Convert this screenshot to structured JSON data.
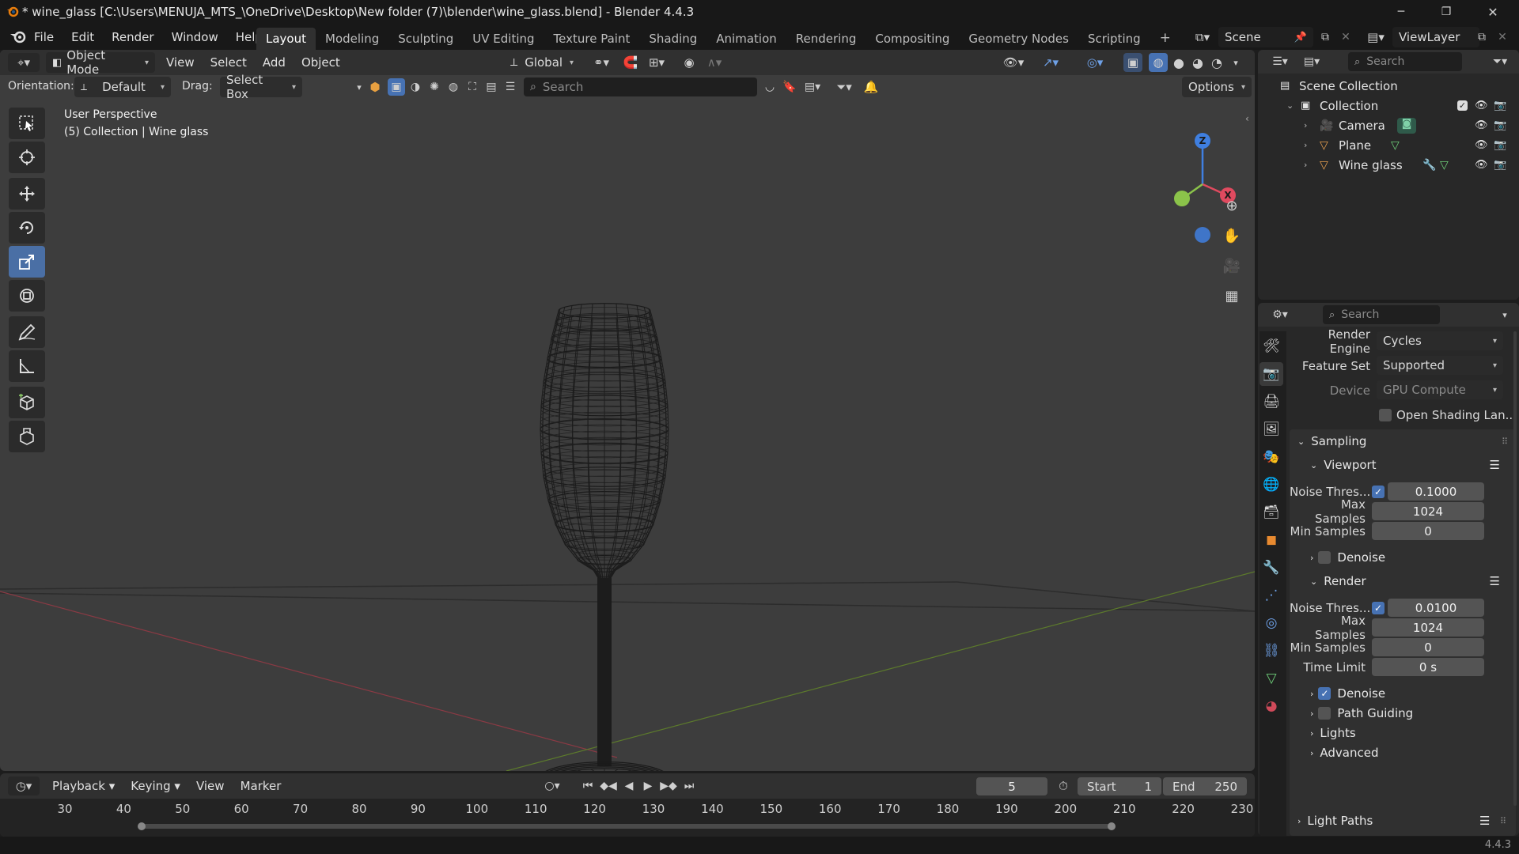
{
  "titlebar": {
    "title": "* wine_glass [C:\\Users\\MENUJA_MTS_\\OneDrive\\Desktop\\New folder (7)\\blender\\wine_glass.blend] - Blender 4.4.3",
    "minimize": "─",
    "maximize": "❐",
    "close": "✕"
  },
  "menubar": {
    "menus": [
      "File",
      "Edit",
      "Render",
      "Window",
      "Help"
    ],
    "workspaces": [
      "Layout",
      "Modeling",
      "Sculpting",
      "UV Editing",
      "Texture Paint",
      "Shading",
      "Animation",
      "Rendering",
      "Compositing",
      "Geometry Nodes",
      "Scripting"
    ],
    "active_workspace": "Layout",
    "add_workspace": "+",
    "scene": "Scene",
    "view_layer": "ViewLayer"
  },
  "viewport_header": {
    "mode": "Object Mode",
    "menus": [
      "View",
      "Select",
      "Add",
      "Object"
    ],
    "orientation_transform": "Global"
  },
  "tool_settings": {
    "orientation_label": "Orientation:",
    "orientation_value": "Default",
    "drag_label": "Drag:",
    "drag_value": "Select Box",
    "search_placeholder": "Search",
    "options": "Options"
  },
  "viewport": {
    "perspective": "User Perspective",
    "collection_info": "(5) Collection | Wine glass",
    "gizmo": {
      "z": "Z",
      "x": "X"
    }
  },
  "outliner": {
    "search_placeholder": "Search",
    "scene_collection": "Scene Collection",
    "collection": "Collection",
    "objects": [
      {
        "name": "Camera",
        "icon": "camera-icon"
      },
      {
        "name": "Plane",
        "icon": "mesh-icon"
      },
      {
        "name": "Wine glass",
        "icon": "mesh-icon"
      }
    ]
  },
  "properties": {
    "search_placeholder": "Search",
    "render_engine_label": "Render Engine",
    "render_engine": "Cycles",
    "feature_set_label": "Feature Set",
    "feature_set": "Supported",
    "device_label": "Device",
    "device": "GPU Compute",
    "osl_label": "Open Shading Lan...",
    "sampling": {
      "title": "Sampling",
      "viewport": {
        "title": "Viewport",
        "noise_label": "Noise Thres...",
        "noise_value": "0.1000",
        "noise_enabled": true,
        "max_samples_label": "Max Samples",
        "max_samples": "1024",
        "min_samples_label": "Min Samples",
        "min_samples": "0",
        "denoise_label": "Denoise",
        "denoise_enabled": false
      },
      "render": {
        "title": "Render",
        "noise_label": "Noise Thres...",
        "noise_value": "0.0100",
        "noise_enabled": true,
        "max_samples_label": "Max Samples",
        "max_samples": "1024",
        "min_samples_label": "Min Samples",
        "min_samples": "0",
        "time_limit_label": "Time Limit",
        "time_limit": "0 s",
        "denoise_label": "Denoise",
        "denoise_enabled": true
      },
      "path_guiding_label": "Path Guiding",
      "lights_label": "Lights",
      "advanced_label": "Advanced"
    },
    "light_paths_label": "Light Paths"
  },
  "timeline": {
    "menus": [
      "Playback",
      "Keying",
      "View",
      "Marker"
    ],
    "current_frame": "5",
    "start_label": "Start",
    "start": "1",
    "end_label": "End",
    "end": "250",
    "ruler": [
      "30",
      "40",
      "50",
      "60",
      "70",
      "80",
      "90",
      "100",
      "110",
      "120",
      "130",
      "140",
      "150",
      "160",
      "170",
      "180",
      "190",
      "200",
      "210",
      "220",
      "230"
    ]
  },
  "statusbar": {
    "version": "4.4.3"
  },
  "colors": {
    "accent": "#4772b3",
    "x_axis": "#e04a5f",
    "y_axis": "#8bc34a",
    "z_axis": "#3f7fe0"
  }
}
